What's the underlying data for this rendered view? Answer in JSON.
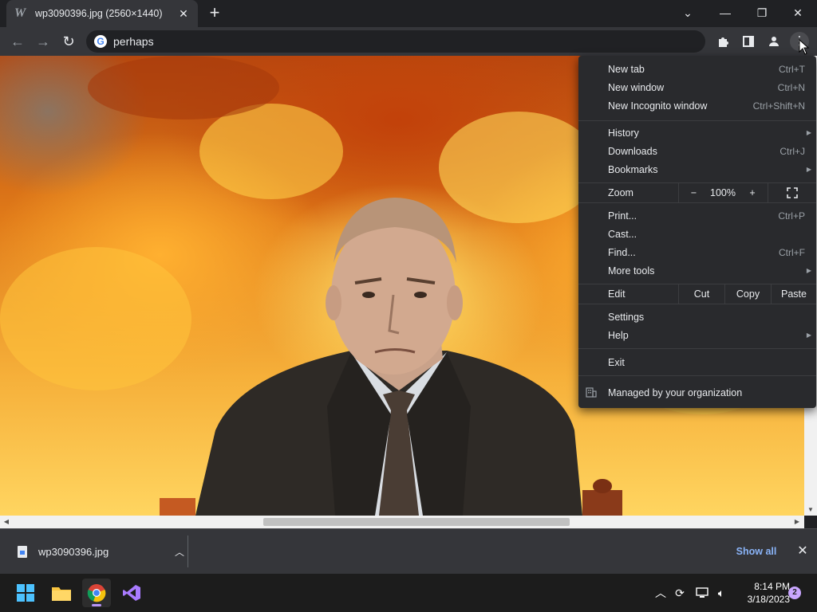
{
  "tab": {
    "title": "wp3090396.jpg (2560×1440)",
    "favicon": "W"
  },
  "address": {
    "value": "perhaps"
  },
  "menu": {
    "group1": [
      {
        "label": "New tab",
        "shortcut": "Ctrl+T"
      },
      {
        "label": "New window",
        "shortcut": "Ctrl+N"
      },
      {
        "label": "New Incognito window",
        "shortcut": "Ctrl+Shift+N"
      }
    ],
    "group2": [
      {
        "label": "History",
        "shortcut": ""
      },
      {
        "label": "Downloads",
        "shortcut": "Ctrl+J"
      },
      {
        "label": "Bookmarks",
        "shortcut": ""
      }
    ],
    "zoom": {
      "label": "Zoom",
      "minus": "−",
      "value": "100%",
      "plus": "+"
    },
    "group3": [
      {
        "label": "Print...",
        "shortcut": "Ctrl+P"
      },
      {
        "label": "Cast...",
        "shortcut": ""
      },
      {
        "label": "Find...",
        "shortcut": "Ctrl+F"
      },
      {
        "label": "More tools",
        "shortcut": ""
      }
    ],
    "edit": {
      "label": "Edit",
      "cut": "Cut",
      "copy": "Copy",
      "paste": "Paste"
    },
    "group4": [
      {
        "label": "Settings"
      },
      {
        "label": "Help"
      }
    ],
    "exit": "Exit",
    "managed": "Managed by your organization"
  },
  "download": {
    "filename": "wp3090396.jpg",
    "show_all": "Show all"
  },
  "taskbar": {
    "time": "8:14 PM",
    "date": "3/18/2023",
    "notifications": "2"
  },
  "colors": {
    "accent": "#8ab4f8",
    "menu_bg": "#292a2d",
    "toolbar_bg": "#35363a",
    "tabstrip_bg": "#202124"
  }
}
